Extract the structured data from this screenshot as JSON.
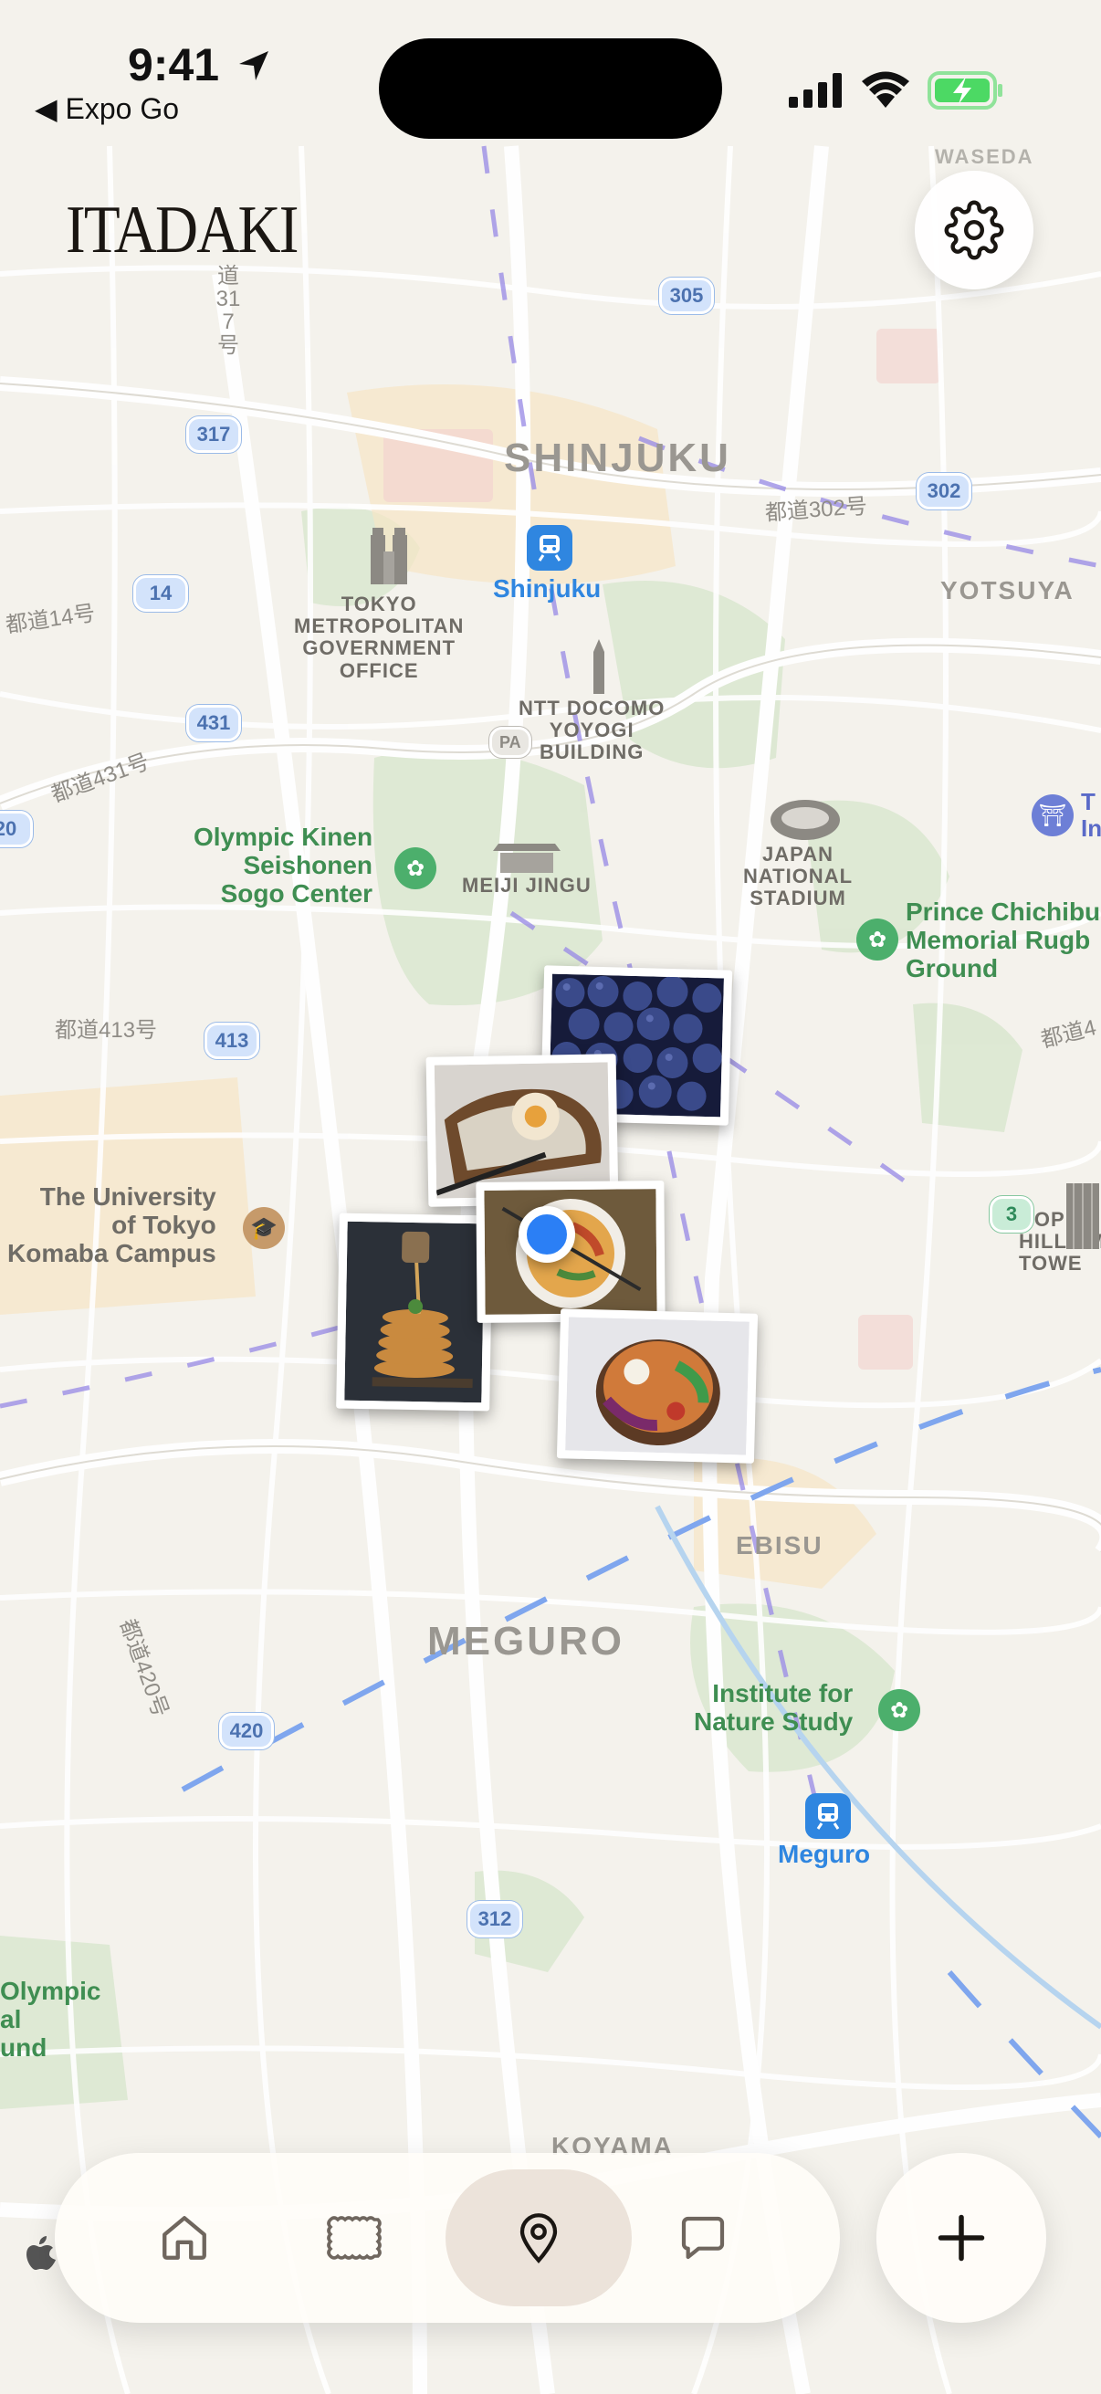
{
  "status_bar": {
    "time": "9:41",
    "back_label": "◀ Expo Go",
    "battery_color": "#4cd964"
  },
  "app": {
    "brand": "ITADAKI",
    "settings_icon": "gear-icon",
    "accent_color": "#1a1612"
  },
  "map": {
    "districts": {
      "shinjuku": "SHINJUKU",
      "meguro": "MEGURO",
      "yotsuya": "YOTSUYA",
      "ebisu": "EBISU",
      "koyama": "KOYAMA",
      "waseda": "WASEDA"
    },
    "landmarks": {
      "tokyo_gov": "TOKYO\nMETROPOLITAN\nGOVERNMENT\nOFFICE",
      "ntt": "NTT DOCOMO\nYOYOGI\nBUILDING",
      "meiji": "MEIJI JINGU",
      "stadium": "JAPAN\nNATIONAL\nSTADIUM",
      "roppongi": "ROPPO\nHILLS M\nTOWE"
    },
    "parks": {
      "olympic_kinen": "Olympic Kinen\nSeishonen\nSogo Center",
      "chichibu": "Prince Chichibu\nMemorial Rugb\nGround",
      "nature_study": "Institute for\nNature Study",
      "olympic_left": "Olympic\nal\nund"
    },
    "places": {
      "u_tokyo": "The University\nof Tokyo\nKomaba Campus",
      "t_in": "T\nIn"
    },
    "stations": {
      "shinjuku": "Shinjuku",
      "meguro": "Meguro"
    },
    "roads": {
      "r302": "都道302号",
      "r14": "都道14号",
      "r431": "都道431号",
      "r413": "都道413号",
      "r420": "都道420号",
      "r317v": "道317号",
      "adv": "都道4"
    },
    "shields": [
      "305",
      "317",
      "302",
      "14",
      "431",
      "20",
      "413",
      "420",
      "312",
      "3"
    ]
  },
  "photos": [
    {
      "name": "blueberries"
    },
    {
      "name": "toast"
    },
    {
      "name": "ramen"
    },
    {
      "name": "pancakes"
    },
    {
      "name": "salad-bowl"
    }
  ],
  "tabbar": {
    "tabs": [
      {
        "icon": "home-icon",
        "label": "Home"
      },
      {
        "icon": "stamp-icon",
        "label": "Stamps"
      },
      {
        "icon": "map-pin-icon",
        "label": "Map",
        "active": true
      },
      {
        "icon": "chat-bubble-icon",
        "label": "Chat"
      }
    ],
    "add_icon": "plus-icon"
  }
}
